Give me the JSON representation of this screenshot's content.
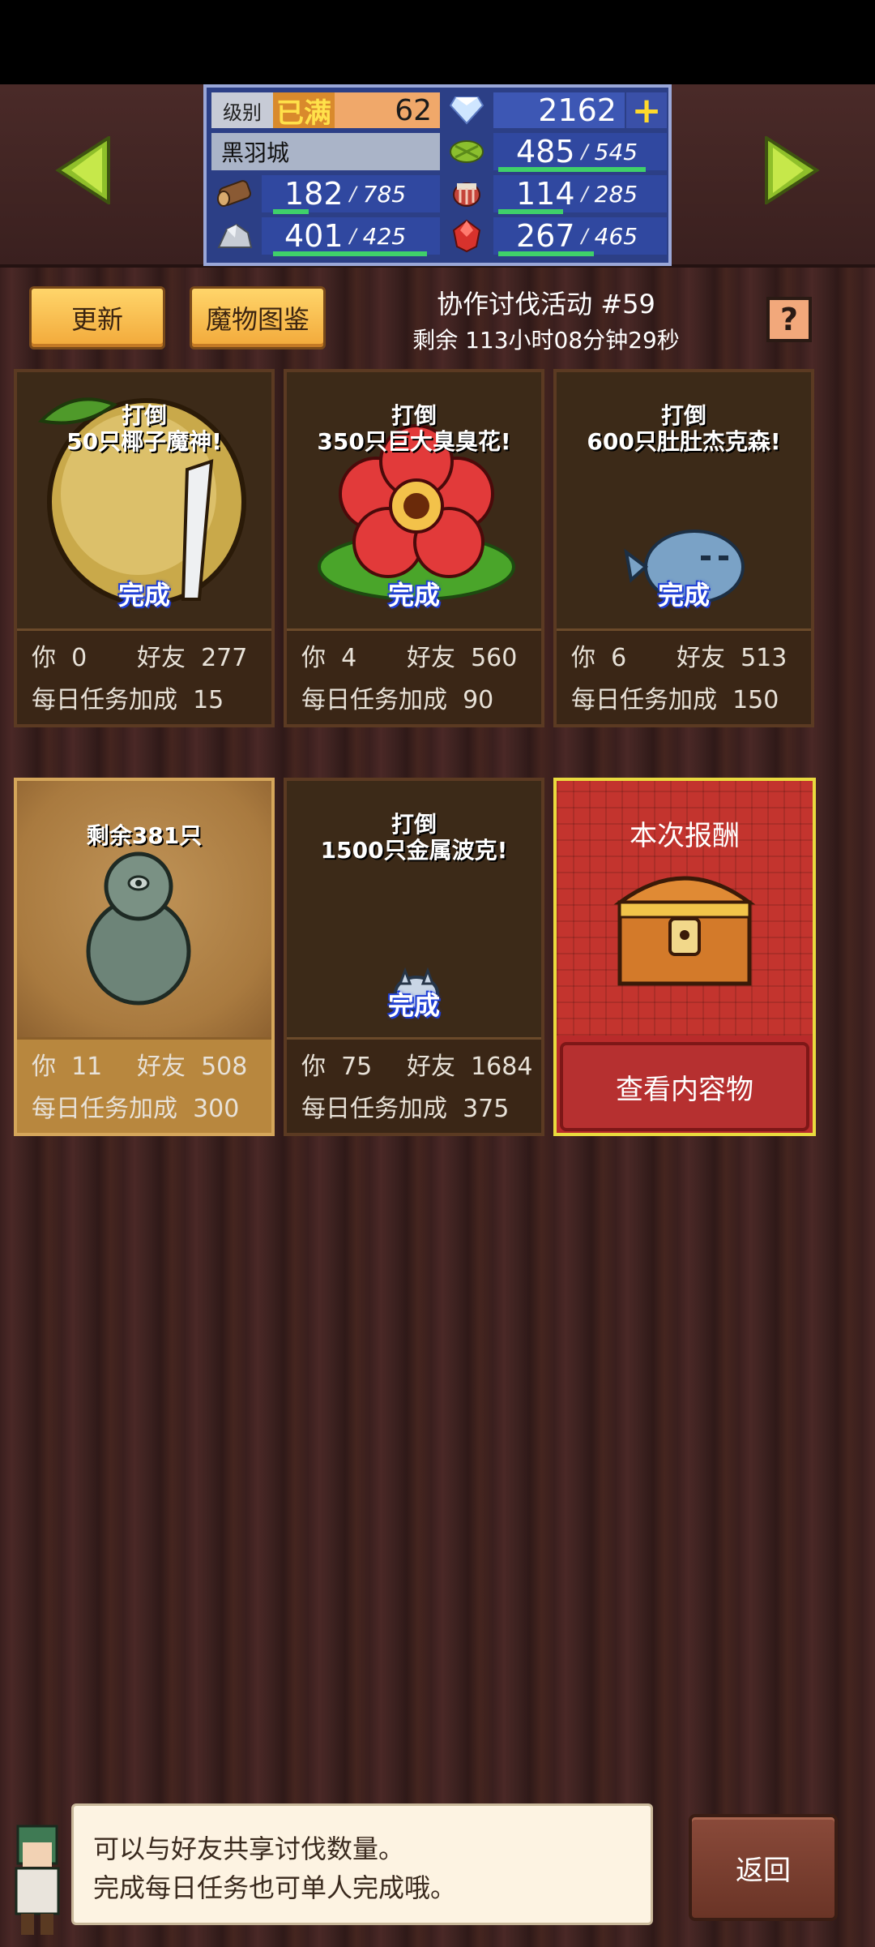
{
  "header": {
    "level_label": "级别",
    "level_badge": "已满",
    "level_value": "62",
    "gems": "2162",
    "city": "黑羽城",
    "resources": [
      {
        "icon": "vegetable-icon",
        "value": "485",
        "cap": "545",
        "fill": 0.89
      },
      {
        "icon": "wood-log-icon",
        "value": "182",
        "cap": "785",
        "fill": 0.23
      },
      {
        "icon": "meat-icon",
        "value": "114",
        "cap": "285",
        "fill": 0.4
      },
      {
        "icon": "ore-icon",
        "value": "401",
        "cap": "425",
        "fill": 0.94
      },
      {
        "icon": "ruby-icon",
        "value": "267",
        "cap": "465",
        "fill": 0.57
      }
    ]
  },
  "toolbar": {
    "refresh_label": "更新",
    "bestiary_label": "魔物图鉴",
    "event_title": "协作讨伐活动 #59",
    "event_time": "剩余 113小时08分钟29秒",
    "help_label": "?"
  },
  "cards": [
    {
      "title1": "打倒",
      "title2": "50只椰子魔神!",
      "status": "完成",
      "you_label": "你",
      "you": "0",
      "friends_label": "好友",
      "friends": "277",
      "bonus_label": "每日任务加成",
      "bonus": "15"
    },
    {
      "title1": "打倒",
      "title2": "350只巨大臭臭花!",
      "status": "完成",
      "you_label": "你",
      "you": "4",
      "friends_label": "好友",
      "friends": "560",
      "bonus_label": "每日任务加成",
      "bonus": "90"
    },
    {
      "title1": "打倒",
      "title2": "600只肚肚杰克森!",
      "status": "完成",
      "you_label": "你",
      "you": "6",
      "friends_label": "好友",
      "friends": "513",
      "bonus_label": "每日任务加成",
      "bonus": "150"
    },
    {
      "title1": "剩余381只",
      "title2": "",
      "status": "",
      "you_label": "你",
      "you": "11",
      "friends_label": "好友",
      "friends": "508",
      "bonus_label": "每日任务加成",
      "bonus": "300"
    },
    {
      "title1": "打倒",
      "title2": "1500只金属波克!",
      "status": "完成",
      "you_label": "你",
      "you": "75",
      "friends_label": "好友",
      "friends": "1684",
      "bonus_label": "每日任务加成",
      "bonus": "375"
    }
  ],
  "reward": {
    "title": "本次报酬",
    "button": "查看内容物"
  },
  "dialog": {
    "line1": "可以与好友共享讨伐数量。",
    "line2": "完成每日任务也可单人完成哦。"
  },
  "footer": {
    "back_label": "返回"
  }
}
